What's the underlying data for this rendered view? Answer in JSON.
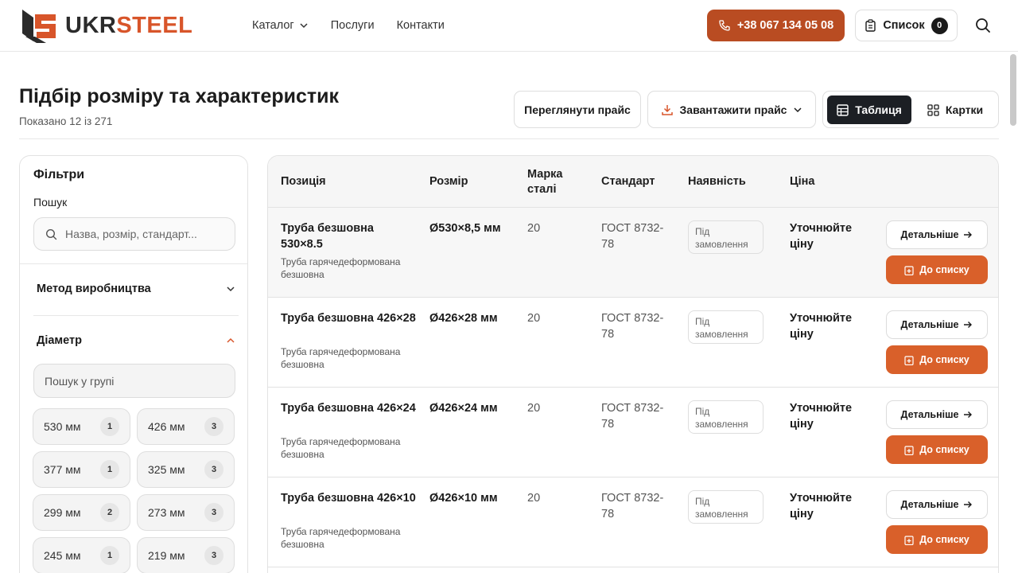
{
  "brand": {
    "part1": "UKR",
    "part2": "STEEL"
  },
  "nav": {
    "catalog": "Каталог",
    "services": "Послуги",
    "contacts": "Контакти"
  },
  "header": {
    "phone": "+38 067 134 05 08",
    "list_label": "Список",
    "list_count": "0"
  },
  "page": {
    "title": "Підбір розміру та характеристик",
    "subtitle": "Показано 12 із 271",
    "view_price": "Переглянути прайс",
    "download_price": "Завантажити прайс",
    "view_table": "Таблиця",
    "view_cards": "Картки"
  },
  "filters": {
    "title": "Фільтри",
    "search_label": "Пошук",
    "search_placeholder": "Назва, розмір, стандарт...",
    "method_label": "Метод виробництва",
    "diameter_label": "Діаметр",
    "group_search_placeholder": "Пошук у групі",
    "chips": [
      {
        "label": "530 мм",
        "count": "1"
      },
      {
        "label": "426 мм",
        "count": "3"
      },
      {
        "label": "377 мм",
        "count": "1"
      },
      {
        "label": "325 мм",
        "count": "3"
      },
      {
        "label": "299 мм",
        "count": "2"
      },
      {
        "label": "273 мм",
        "count": "3"
      },
      {
        "label": "245 мм",
        "count": "1"
      },
      {
        "label": "219 мм",
        "count": "3"
      }
    ]
  },
  "table": {
    "headers": {
      "position": "Позиція",
      "size": "Розмір",
      "grade": "Марка сталі",
      "standard": "Стандарт",
      "availability": "Наявність",
      "price": "Ціна"
    },
    "detail_label": "Детальніше",
    "add_label": "До списку",
    "rows": [
      {
        "title": "Труба безшовна 530×8.5",
        "desc": "Труба гарячедеформована безшовна",
        "size": "Ø530×8,5 мм",
        "grade": "20",
        "standard": "ГОСТ 8732-78",
        "availability": "Під замовлення",
        "price": "Уточнюйте ціну"
      },
      {
        "title": "Труба безшовна 426×28",
        "desc": "Труба гарячедеформована безшовна",
        "size": "Ø426×28 мм",
        "grade": "20",
        "standard": "ГОСТ 8732-78",
        "availability": "Під замовлення",
        "price": "Уточнюйте ціну"
      },
      {
        "title": "Труба безшовна 426×24",
        "desc": "Труба гарячедеформована безшовна",
        "size": "Ø426×24 мм",
        "grade": "20",
        "standard": "ГОСТ 8732-78",
        "availability": "Під замовлення",
        "price": "Уточнюйте ціну"
      },
      {
        "title": "Труба безшовна 426×10",
        "desc": "Труба гарячедеформована безшовна",
        "size": "Ø426×10 мм",
        "grade": "20",
        "standard": "ГОСТ 8732-78",
        "availability": "Під замовлення",
        "price": "Уточнюйте ціну"
      }
    ]
  },
  "colors": {
    "brand_orange": "#d8552a",
    "phone_button": "#b94c22",
    "add_button": "#d9602a",
    "dark": "#1c1f24"
  }
}
